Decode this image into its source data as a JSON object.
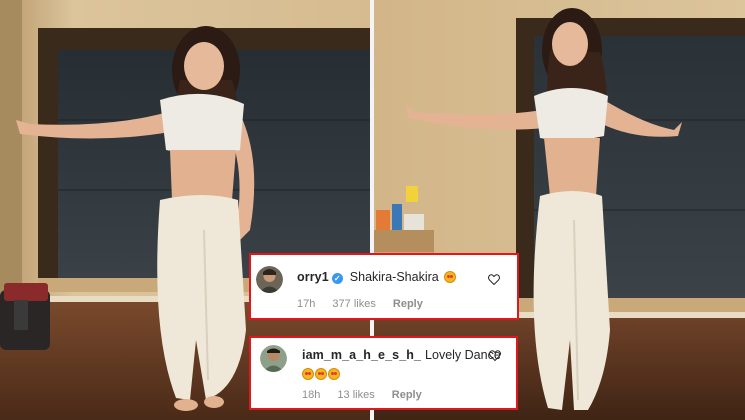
{
  "comments": [
    {
      "username": "orry1",
      "verified": true,
      "text": "Shakira-Shakira",
      "emoji_count": 1,
      "time": "17h",
      "likes": "377 likes",
      "reply": "Reply"
    },
    {
      "username": "iam_m_a_h_e_s_h_",
      "verified": false,
      "text": "Lovely Dance",
      "emoji_count": 3,
      "time": "18h",
      "likes": "13 likes",
      "reply": "Reply"
    }
  ],
  "icons": {
    "verified": "verified-badge-icon",
    "like": "heart-outline-icon",
    "emoji": "star-struck-emoji-icon"
  },
  "colors": {
    "card_border": "#e0181b",
    "verified_blue": "#3897f0",
    "meta_gray": "#8e8e8e",
    "wall": "#d9bf95",
    "window_blind": "#2a3137"
  }
}
